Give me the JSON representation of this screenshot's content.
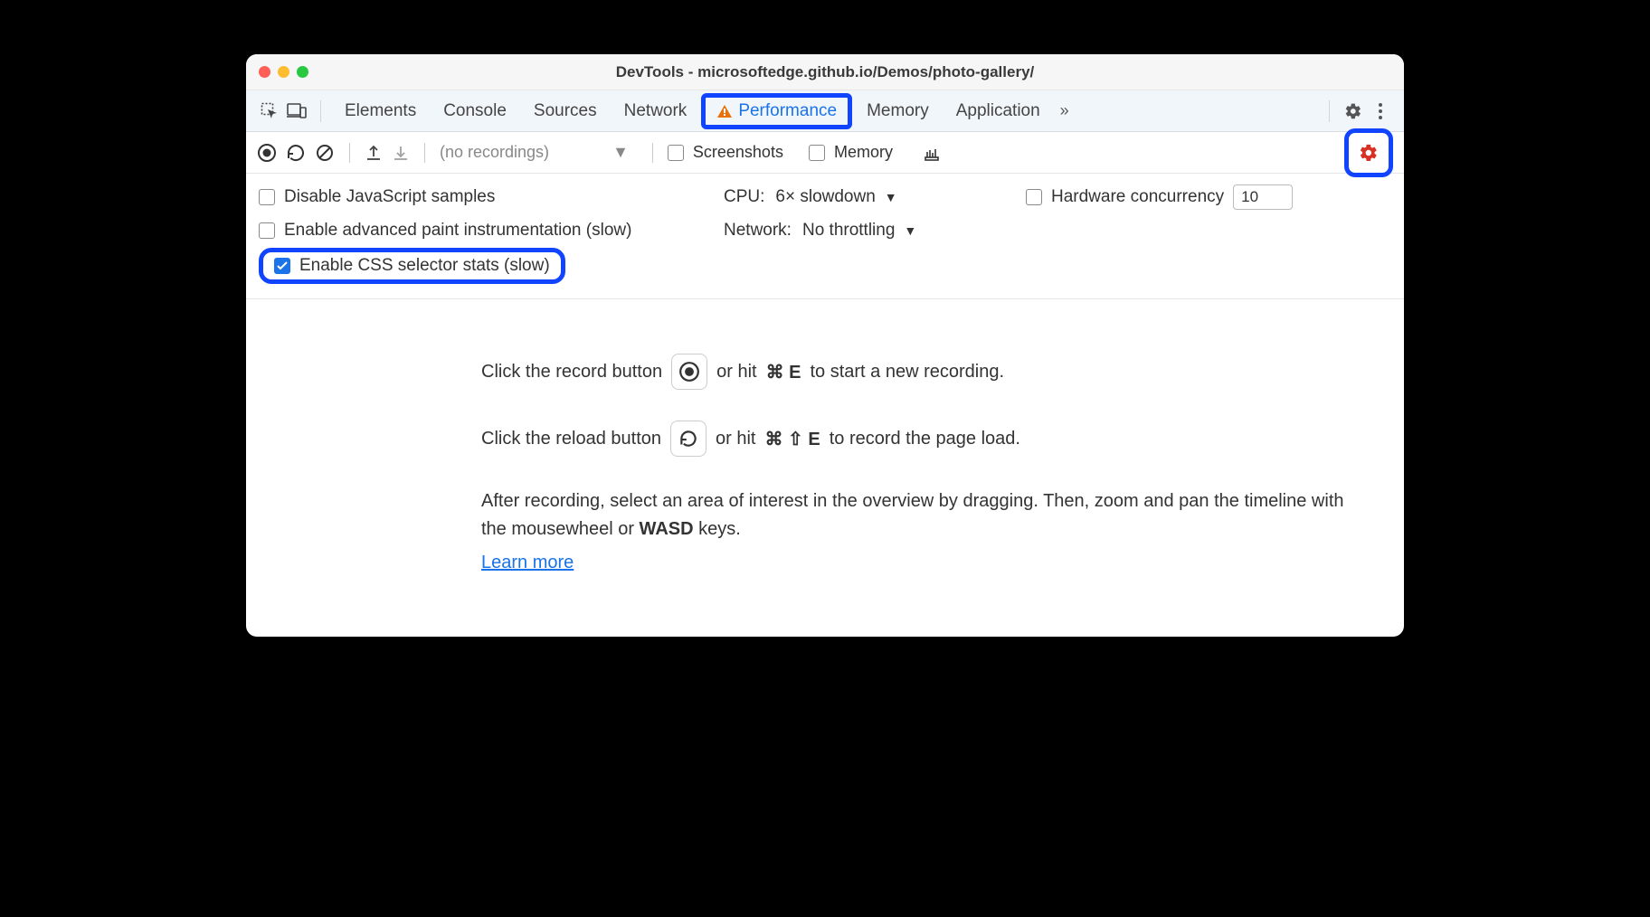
{
  "window": {
    "title": "DevTools - microsoftedge.github.io/Demos/photo-gallery/"
  },
  "tabs": {
    "elements": "Elements",
    "console": "Console",
    "sources": "Sources",
    "network": "Network",
    "performance": "Performance",
    "memory": "Memory",
    "application": "Application",
    "more": "»"
  },
  "toolbar": {
    "recordings_placeholder": "(no recordings)",
    "screenshots_label": "Screenshots",
    "memory_label": "Memory"
  },
  "settings": {
    "disable_js_samples": "Disable JavaScript samples",
    "enable_paint_instr": "Enable advanced paint instrumentation (slow)",
    "enable_css_stats": "Enable CSS selector stats (slow)",
    "cpu_label": "CPU:",
    "cpu_value": "6× slowdown",
    "network_label": "Network:",
    "network_value": "No throttling",
    "hw_concurrency_label": "Hardware concurrency",
    "hw_concurrency_value": "10"
  },
  "help": {
    "line1_a": "Click the record button",
    "line1_b": "or hit",
    "line1_kbd": "⌘ E",
    "line1_c": "to start a new recording.",
    "line2_a": "Click the reload button",
    "line2_b": "or hit",
    "line2_kbd": "⌘ ⇧ E",
    "line2_c": "to record the page load.",
    "line3": "After recording, select an area of interest in the overview by dragging. Then, zoom and pan the timeline with the mousewheel or ",
    "wasd": "WASD",
    "line3_end": " keys.",
    "learn_more": "Learn more"
  }
}
